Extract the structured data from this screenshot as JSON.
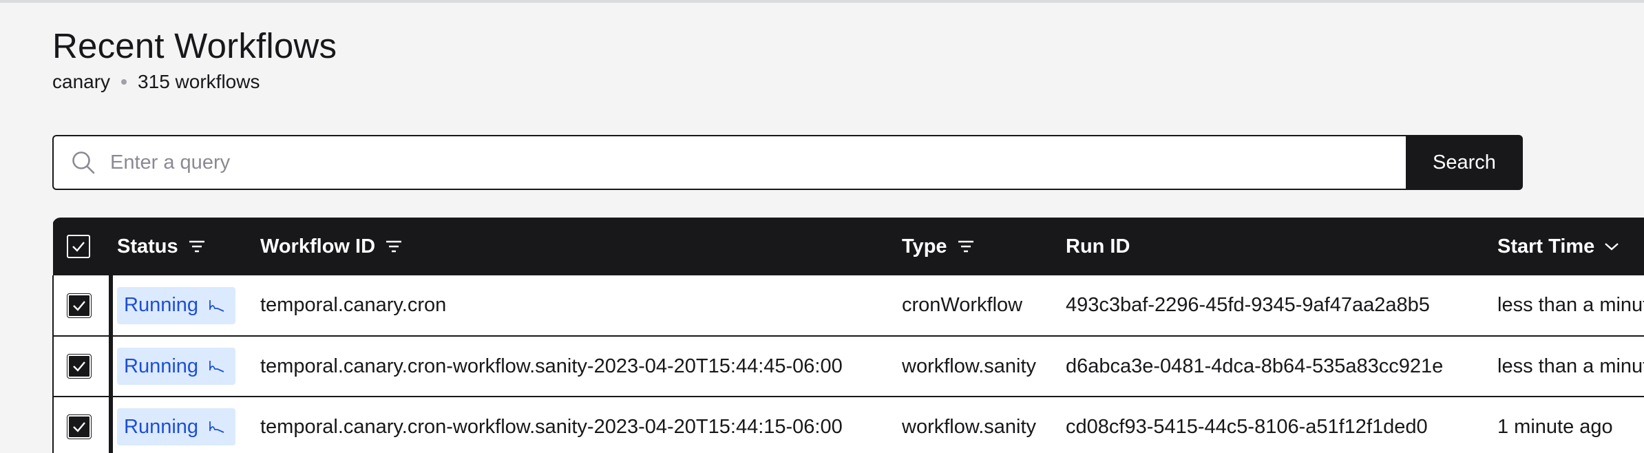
{
  "header": {
    "title": "Recent Workflows",
    "namespace": "canary",
    "workflow_count": "315 workflows"
  },
  "search": {
    "placeholder": "Enter a query",
    "value": "",
    "button_label": "Search"
  },
  "table": {
    "columns": {
      "status": "Status",
      "workflow_id": "Workflow ID",
      "type": "Type",
      "run_id": "Run ID",
      "start_time": "Start Time"
    },
    "header_checkbox_checked": true,
    "rows": [
      {
        "checked": true,
        "status": "Running",
        "workflow_id": "temporal.canary.cron",
        "type": "cronWorkflow",
        "run_id": "493c3baf-2296-45fd-9345-9af47aa2a8b5",
        "start_time": "less than a minute ago"
      },
      {
        "checked": true,
        "status": "Running",
        "workflow_id": "temporal.canary.cron-workflow.sanity-2023-04-20T15:44:45-06:00",
        "type": "workflow.sanity",
        "run_id": "d6abca3e-0481-4dca-8b64-535a83cc921e",
        "start_time": "less than a minute ago"
      },
      {
        "checked": true,
        "status": "Running",
        "workflow_id": "temporal.canary.cron-workflow.sanity-2023-04-20T15:44:15-06:00",
        "type": "workflow.sanity",
        "run_id": "cd08cf93-5415-44c5-8106-a51f12f1ded0",
        "start_time": "1 minute ago"
      }
    ]
  },
  "icons": {
    "search": "search-icon",
    "filter": "filter-icon",
    "sort": "chevron-down-icon",
    "check": "check-icon",
    "running": "running-icon"
  },
  "colors": {
    "background": "#f4f4f5",
    "primary_dark": "#18181b",
    "running_badge_bg": "#dbeafe",
    "running_badge_text": "#1d4ed8"
  }
}
